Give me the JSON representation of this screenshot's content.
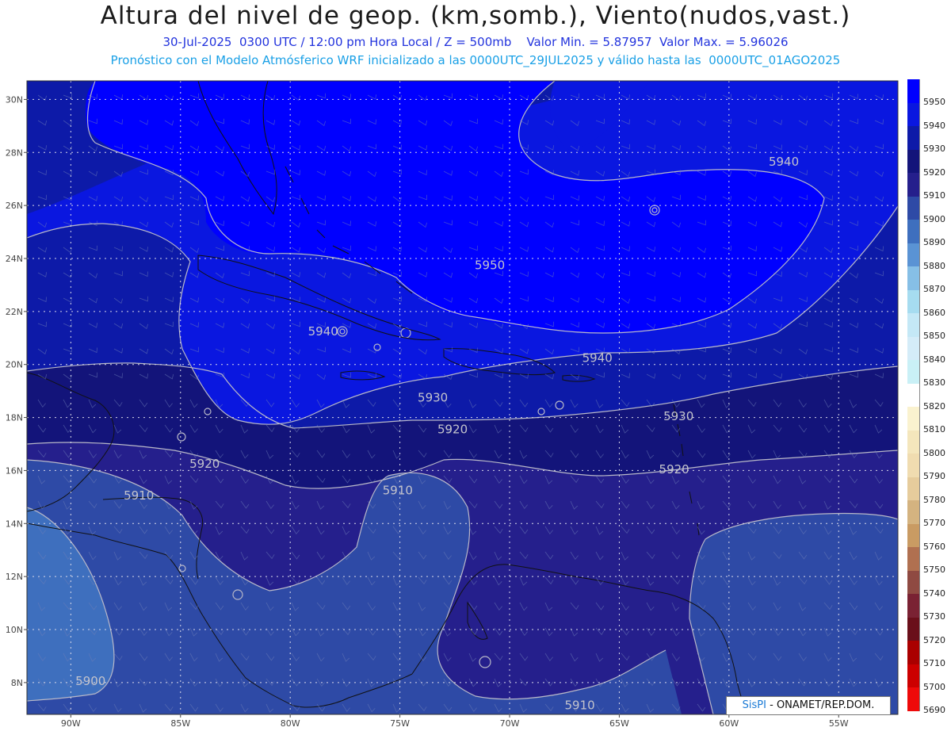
{
  "header": {
    "title": "Altura del nivel de geop. (km,somb.), Viento(nudos,vast.)",
    "subtitle": "30-Jul-2025  0300 UTC / 12:00 pm Hora Local / Z = 500mb    Valor Min. = 5.87957  Valor Max. = 5.96026",
    "info": "Pronóstico con el Modelo Atmósferico WRF inicializado a las 0000UTC_29JUL2025 y válido hasta las  0000UTC_01AGO2025"
  },
  "axes": {
    "lon_labels": [
      "90W",
      "85W",
      "80W",
      "75W",
      "70W",
      "65W",
      "60W",
      "55W"
    ],
    "lat_labels": [
      "30N",
      "28N",
      "26N",
      "24N",
      "22N",
      "20N",
      "18N",
      "16N",
      "14N",
      "12N",
      "10N",
      "8N"
    ]
  },
  "contour_labels": [
    {
      "id": "c5950",
      "text": "5950",
      "lon": -70.9,
      "lat": 23.6
    },
    {
      "id": "c5940a",
      "text": "5940",
      "lon": -57.5,
      "lat": 27.5
    },
    {
      "id": "c5940b",
      "text": "5940",
      "lon": -78.5,
      "lat": 21.1
    },
    {
      "id": "c5940c",
      "text": "5940",
      "lon": -66.0,
      "lat": 20.1
    },
    {
      "id": "c5930a",
      "text": "5930",
      "lon": -73.5,
      "lat": 18.6
    },
    {
      "id": "c5930b",
      "text": "5930",
      "lon": -62.3,
      "lat": 17.9
    },
    {
      "id": "c5920a",
      "text": "5920",
      "lon": -72.6,
      "lat": 17.4
    },
    {
      "id": "c5920b",
      "text": "5920",
      "lon": -62.5,
      "lat": 15.9
    },
    {
      "id": "c5920c",
      "text": "5920",
      "lon": -83.9,
      "lat": 16.1
    },
    {
      "id": "c5910a",
      "text": "5910",
      "lon": -75.1,
      "lat": 15.1
    },
    {
      "id": "c5910b",
      "text": "5910",
      "lon": -86.9,
      "lat": 14.9
    },
    {
      "id": "c5910c",
      "text": "5910",
      "lon": -66.8,
      "lat": 7.0
    },
    {
      "id": "c5900",
      "text": "5900",
      "lon": -89.1,
      "lat": 7.9
    }
  ],
  "colorbar": {
    "levels": [
      "5950",
      "5940",
      "5930",
      "5920",
      "5910",
      "5900",
      "5890",
      "5880",
      "5870",
      "5860",
      "5850",
      "5840",
      "5830",
      "5820",
      "5810",
      "5800",
      "5790",
      "5780",
      "5770",
      "5760",
      "5750",
      "5740",
      "5730",
      "5720",
      "5710",
      "5700",
      "5690"
    ],
    "colors": [
      "#0000ff",
      "#0a17e0",
      "#0d1aa8",
      "#13147a",
      "#251f8c",
      "#2e4aa6",
      "#3e6fbe",
      "#5a93d4",
      "#86bfe6",
      "#a6dcf0",
      "#c4e8f6",
      "#d4ecf8",
      "#c9f0f6",
      "#ffffff",
      "#faf2cf",
      "#f4e6bc",
      "#f0dcb0",
      "#e6cc9c",
      "#d4b380",
      "#c99b63",
      "#b07050",
      "#8f4a42",
      "#7a2233",
      "#6a0f1a",
      "#aa0000",
      "#cc0000",
      "#ee0a0a"
    ]
  },
  "credit": {
    "sis": "SisPI",
    "rest": " - ONAMET/REP.DOM."
  },
  "colors": {
    "ocean_5950": "#0000ff",
    "zone_5940": "#0a17e0",
    "zone_5930": "#0d1aa8",
    "zone_5920": "#13147a",
    "zone_5910": "#251f8c",
    "zone_5900": "#2e4aa6",
    "zone_5890": "#3e6fbe"
  }
}
